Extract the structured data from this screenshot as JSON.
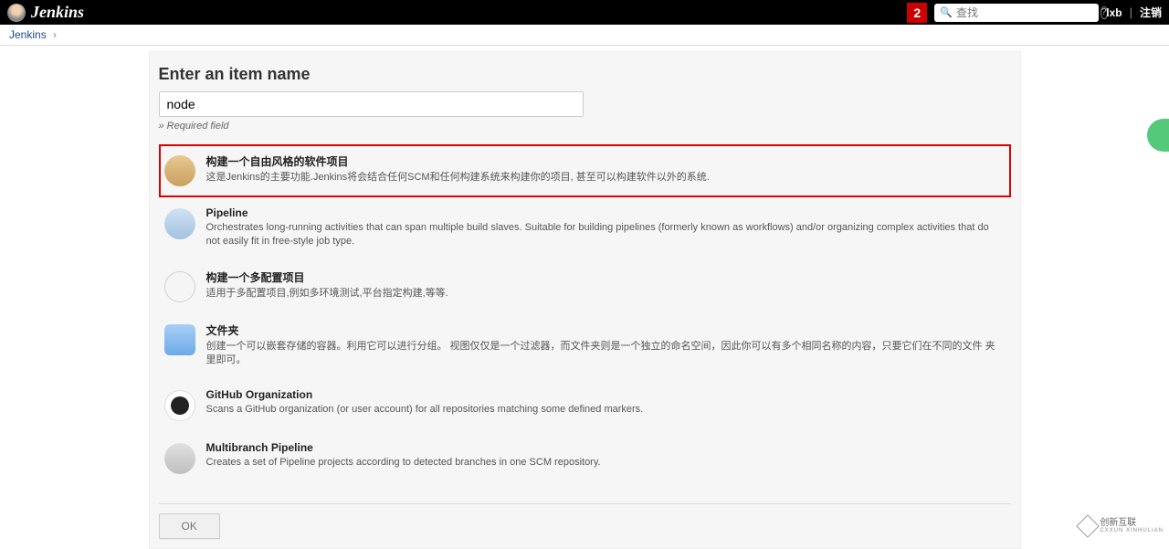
{
  "header": {
    "brand": "Jenkins",
    "notifications": "2",
    "search_placeholder": "查找",
    "user": "lxb",
    "logout": "注销"
  },
  "breadcrumb": {
    "items": [
      "Jenkins"
    ]
  },
  "page": {
    "title": "Enter an item name",
    "input_value": "node",
    "required_hint": "» Required field",
    "ok_label": "OK"
  },
  "options": [
    {
      "icon": "freestyle",
      "title": "构建一个自由风格的软件项目",
      "desc": "这是Jenkins的主要功能.Jenkins将会结合任何SCM和任何构建系统来构建你的项目, 甚至可以构建软件以外的系统.",
      "selected": true
    },
    {
      "icon": "pipeline",
      "title": "Pipeline",
      "desc": "Orchestrates long-running activities that can span multiple build slaves. Suitable for building pipelines (formerly known as workflows) and/or organizing complex activities that do not easily fit in free-style job type.",
      "selected": false
    },
    {
      "icon": "multiconf",
      "title": "构建一个多配置项目",
      "desc": "适用于多配置项目,例如多环境测试,平台指定构建,等等.",
      "selected": false
    },
    {
      "icon": "folder",
      "title": "文件夹",
      "desc": "创建一个可以嵌套存储的容器。利用它可以进行分组。 视图仅仅是一个过滤器，而文件夹则是一个独立的命名空间，因此你可以有多个相同名称的内容，只要它们在不同的文件 夹里即可。",
      "selected": false
    },
    {
      "icon": "github",
      "title": "GitHub Organization",
      "desc": "Scans a GitHub organization (or user account) for all repositories matching some defined markers.",
      "selected": false
    },
    {
      "icon": "multibranch",
      "title": "Multibranch Pipeline",
      "desc": "Creates a set of Pipeline projects according to detected branches in one SCM repository.",
      "selected": false
    }
  ],
  "watermark": {
    "brand": "创新互联",
    "sub": "CXXUN XINHULIAN"
  }
}
